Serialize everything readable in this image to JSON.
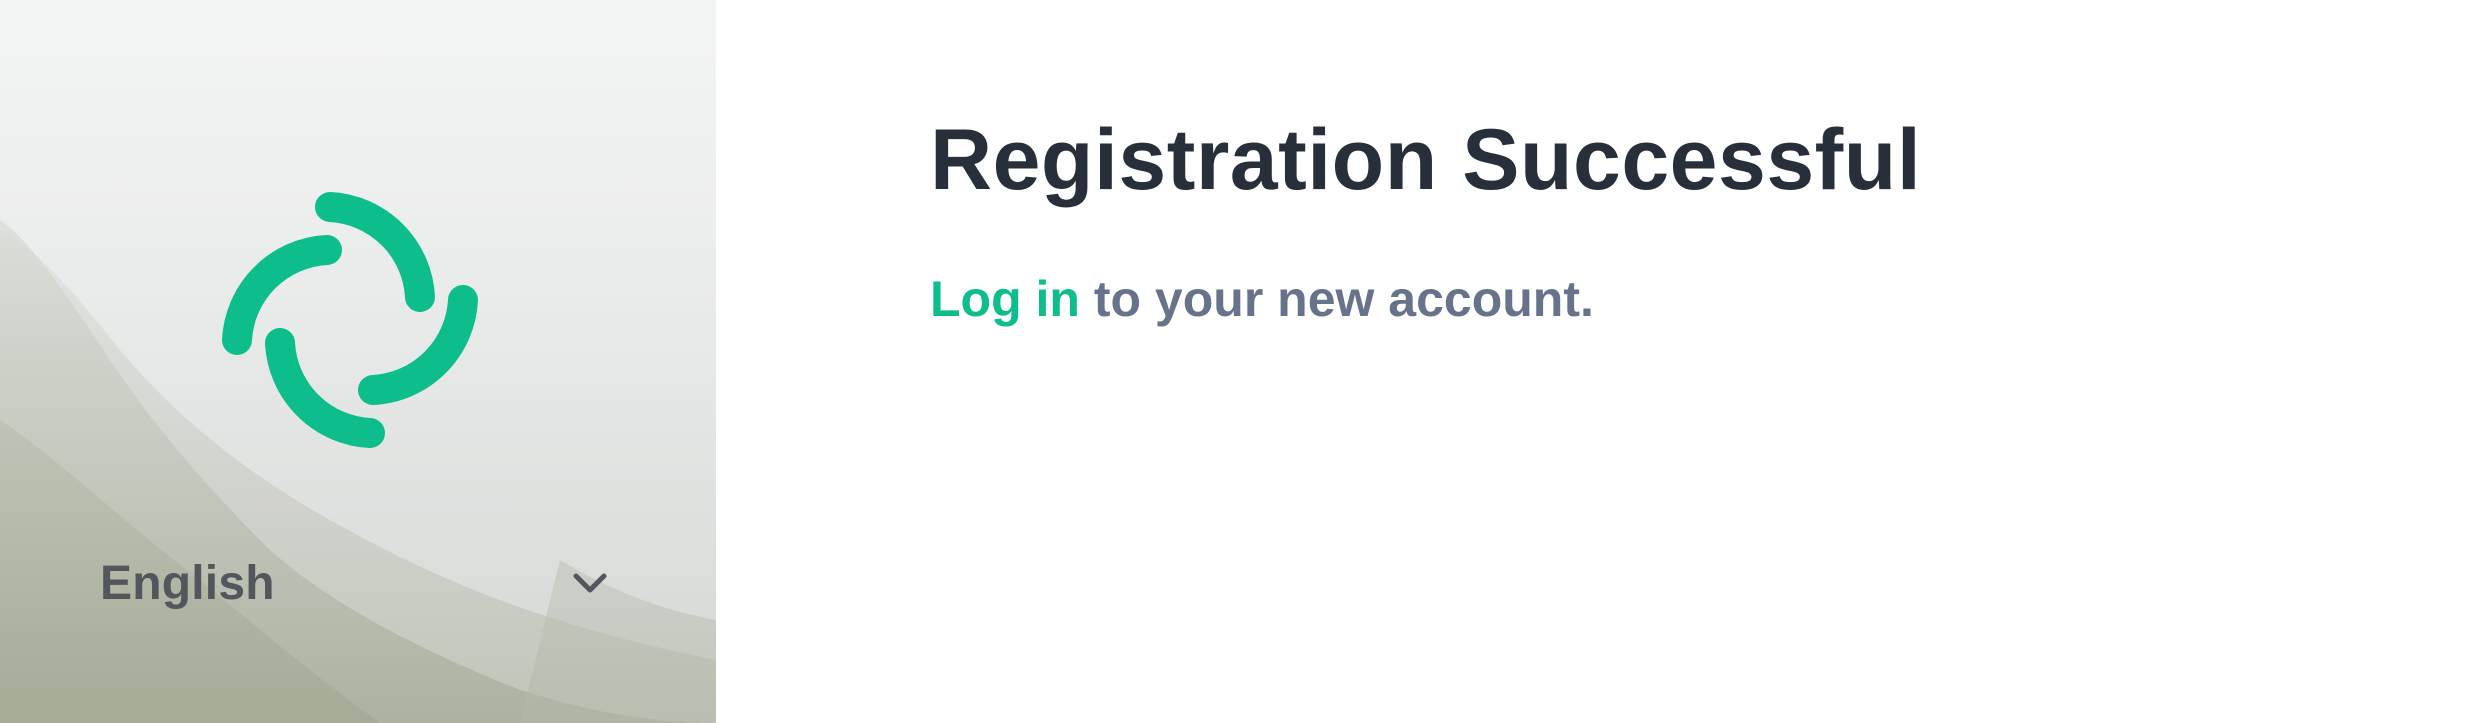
{
  "sidebar": {
    "logo_icon": "element-logo-icon",
    "language": {
      "selected": "English",
      "icon": "chevron-down-icon"
    }
  },
  "main": {
    "title": "Registration Successful",
    "message": {
      "link_text": "Log in",
      "rest_text": " to your new account."
    }
  },
  "colors": {
    "accent": "#0dbd8b",
    "title": "#27303a",
    "message": "#67738b",
    "language_label": "#51575d"
  }
}
